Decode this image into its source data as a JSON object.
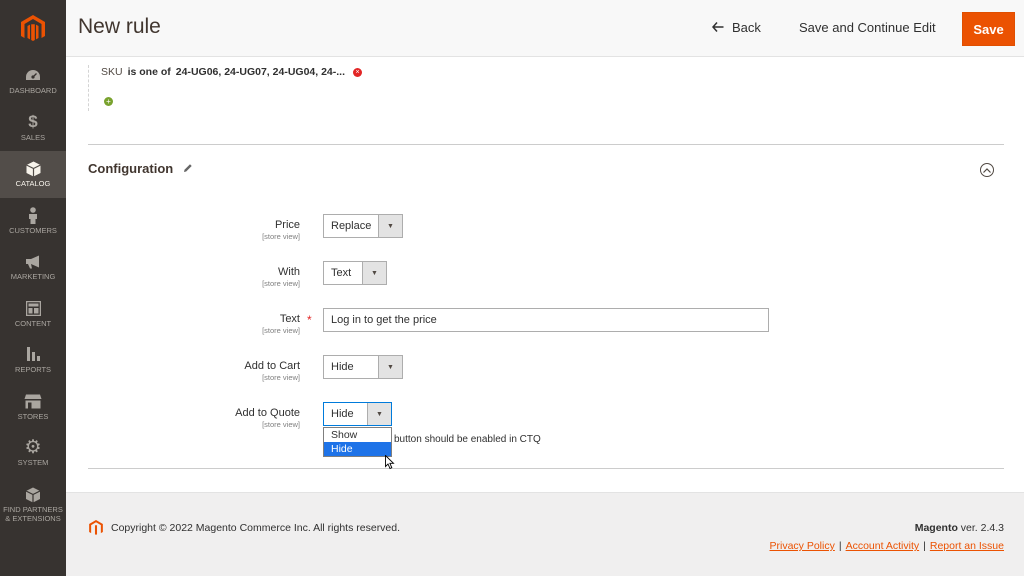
{
  "sidebar": {
    "items": [
      {
        "label": "Dashboard",
        "icon": "dashboard-icon"
      },
      {
        "label": "Sales",
        "icon": "dollar-icon"
      },
      {
        "label": "Catalog",
        "icon": "box-icon"
      },
      {
        "label": "Customers",
        "icon": "person-icon"
      },
      {
        "label": "Marketing",
        "icon": "megaphone-icon"
      },
      {
        "label": "Content",
        "icon": "layout-icon"
      },
      {
        "label": "Reports",
        "icon": "bar-chart-icon"
      },
      {
        "label": "Stores",
        "icon": "store-icon"
      },
      {
        "label": "System",
        "icon": "gear-icon"
      },
      {
        "label": "Find Partners & Extensions",
        "icon": "cube-icon"
      }
    ],
    "active": "Catalog"
  },
  "header": {
    "title": "New rule",
    "back_label": "Back",
    "save_continue_label": "Save and Continue Edit",
    "save_label": "Save"
  },
  "condition": {
    "attribute": "SKU",
    "operator": "is one of",
    "value": "24-UG06, 24-UG07, 24-UG04, 24-..."
  },
  "configuration": {
    "title": "Configuration",
    "scope_label": "[store view]",
    "fields": {
      "price": {
        "label": "Price",
        "value": "Replace"
      },
      "with": {
        "label": "With",
        "value": "Text"
      },
      "text": {
        "label": "Text",
        "value": "Log in to get the price"
      },
      "add_to_cart": {
        "label": "Add to Cart",
        "value": "Hide"
      },
      "add_to_quote": {
        "label": "Add to Quote",
        "value": "Hide",
        "options": [
          "Show",
          "Hide"
        ],
        "note": "button should be enabled in CTQ"
      }
    }
  },
  "footer": {
    "copyright": "Copyright © 2022 Magento Commerce Inc. All rights reserved.",
    "brand": "Magento",
    "version": "ver. 2.4.3",
    "links": [
      "Privacy Policy",
      "Account Activity",
      "Report an Issue"
    ],
    "link_separator": "|"
  },
  "colors": {
    "accent": "#eb5202",
    "sidebar_bg": "#373330",
    "selected_option": "#1e73e8"
  }
}
